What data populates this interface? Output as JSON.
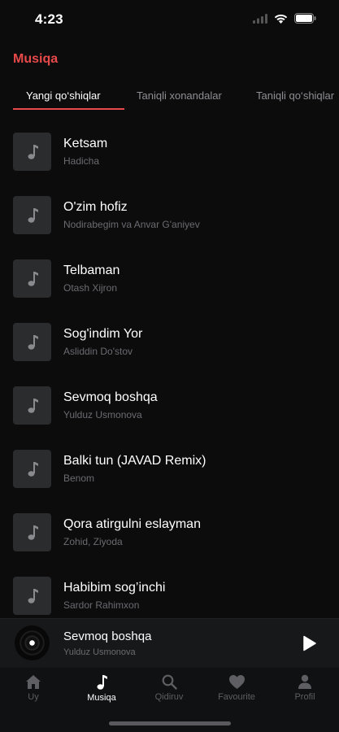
{
  "status_bar": {
    "time": "4:23",
    "icons": [
      "signal-icon",
      "wifi-icon",
      "battery-icon"
    ]
  },
  "app": {
    "title": "Musiqa",
    "accent_color": "#e8494a"
  },
  "tabs": [
    {
      "label": "Yangi qo‘shiqlar",
      "active": true
    },
    {
      "label": "Taniqli xonandalar",
      "active": false
    },
    {
      "label": "Taniqli qo‘shiqlar",
      "active": false
    }
  ],
  "songs": [
    {
      "title": "Ketsam",
      "artist": "Hadicha"
    },
    {
      "title": "O'zim hofiz",
      "artist": "Nodirabegim va Anvar G'aniyev"
    },
    {
      "title": "Telbaman",
      "artist": "Otash Xijron"
    },
    {
      "title": "Sog'indim Yor",
      "artist": "Asliddin Do'stov"
    },
    {
      "title": "Sevmoq boshqa",
      "artist": "Yulduz Usmonova"
    },
    {
      "title": "Balki tun (JAVAD Remix)",
      "artist": "Benom"
    },
    {
      "title": "Qora atirgulni eslayman",
      "artist": "Zohid, Ziyoda"
    },
    {
      "title": "Habibim sog’inchi",
      "artist": "Sardor Rahimxon"
    }
  ],
  "now_playing": {
    "title": "Sevmoq boshqa",
    "artist": "Yulduz Usmonova",
    "icon": "play-icon"
  },
  "tabbar": [
    {
      "label": "Uy",
      "icon": "home-icon",
      "active": false
    },
    {
      "label": "Musiqa",
      "icon": "music-note-icon",
      "active": true
    },
    {
      "label": "Qidiruv",
      "icon": "search-icon",
      "active": false
    },
    {
      "label": "Favourite",
      "icon": "heart-icon",
      "active": false
    },
    {
      "label": "Profil",
      "icon": "profile-icon",
      "active": false
    }
  ]
}
